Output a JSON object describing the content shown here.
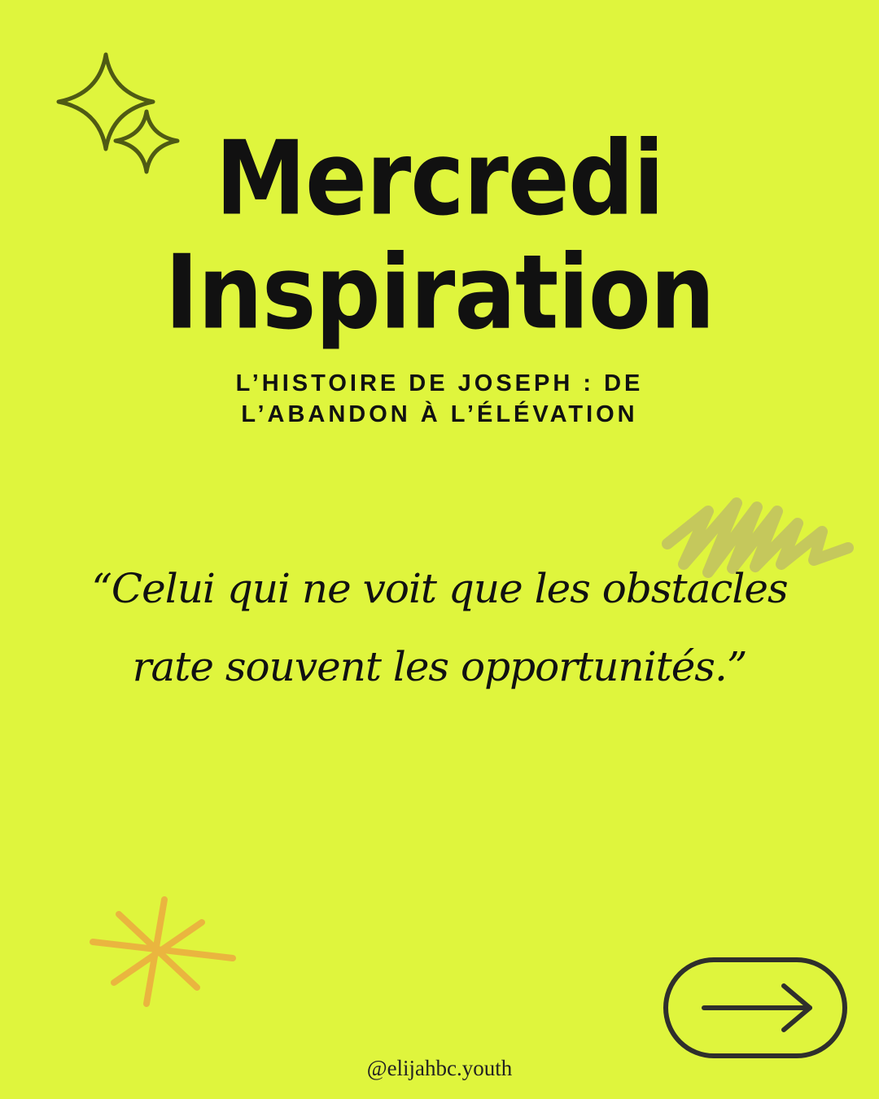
{
  "colors": {
    "background": "#dff53d",
    "text": "#111111",
    "sparkle": "#4f5a14",
    "scribble": "#c5c85c",
    "starburst": "#eab53f",
    "button_border": "#2f2f2c"
  },
  "title": {
    "line1": "Mercredi",
    "line2": "Inspiration"
  },
  "subtitle": {
    "line1": "L’HISTOIRE DE JOSEPH : DE",
    "line2": "L’ABANDON À L’ÉLÉVATION"
  },
  "quote": {
    "line1": "“Celui qui ne voit que les obstacles",
    "line2": "rate souvent les opportunités.”"
  },
  "footer": {
    "handle": "@elijahbc.youth"
  },
  "icons": {
    "top_left": "sparkle-stars-icon",
    "scribble": "scribble-decoration",
    "bottom_left": "starburst-icon",
    "next": "arrow-right-icon"
  }
}
